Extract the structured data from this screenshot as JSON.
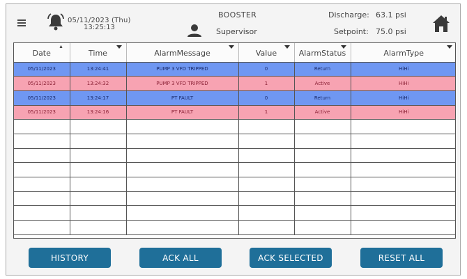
{
  "header": {
    "date": "05/11/2023 (Thu)",
    "time": "13:25:13",
    "station": "BOOSTER",
    "user_role": "Supervisor",
    "discharge_label": "Discharge:",
    "discharge_value": "63.1 psi",
    "setpoint_label": "Setpoint:",
    "setpoint_value": "75.0 psi"
  },
  "table": {
    "columns": [
      "Date",
      "Time",
      "AlarmMessage",
      "Value",
      "AlarmStatus",
      "AlarmType"
    ],
    "rows": [
      {
        "date": "05/11/2023",
        "time": "13:24:41",
        "message": "PUMP 3 VFD TRIPPED",
        "value": "0",
        "status": "Return",
        "type": "HiHi",
        "color": "blue"
      },
      {
        "date": "05/11/2023",
        "time": "13:24:32",
        "message": "PUMP 3 VFD TRIPPED",
        "value": "1",
        "status": "Active",
        "type": "HiHi",
        "color": "pink"
      },
      {
        "date": "05/11/2023",
        "time": "13:24:17",
        "message": "PT FAULT",
        "value": "0",
        "status": "Return",
        "type": "HiHi",
        "color": "blue"
      },
      {
        "date": "05/11/2023",
        "time": "13:24:16",
        "message": "PT FAULT",
        "value": "1",
        "status": "Active",
        "type": "HiHi",
        "color": "pink"
      }
    ],
    "empty_rows": 8
  },
  "buttons": {
    "history": "HISTORY",
    "ack_all": "ACK ALL",
    "ack_selected": "ACK SELECTED",
    "reset_all": "RESET ALL"
  },
  "colors": {
    "return_row": "#6f97f2",
    "active_row": "#f7a3b2",
    "button": "#1f6f99"
  },
  "icons": {
    "menu": "menu-icon",
    "bell": "bell-icon",
    "user": "user-icon",
    "home": "home-icon"
  }
}
